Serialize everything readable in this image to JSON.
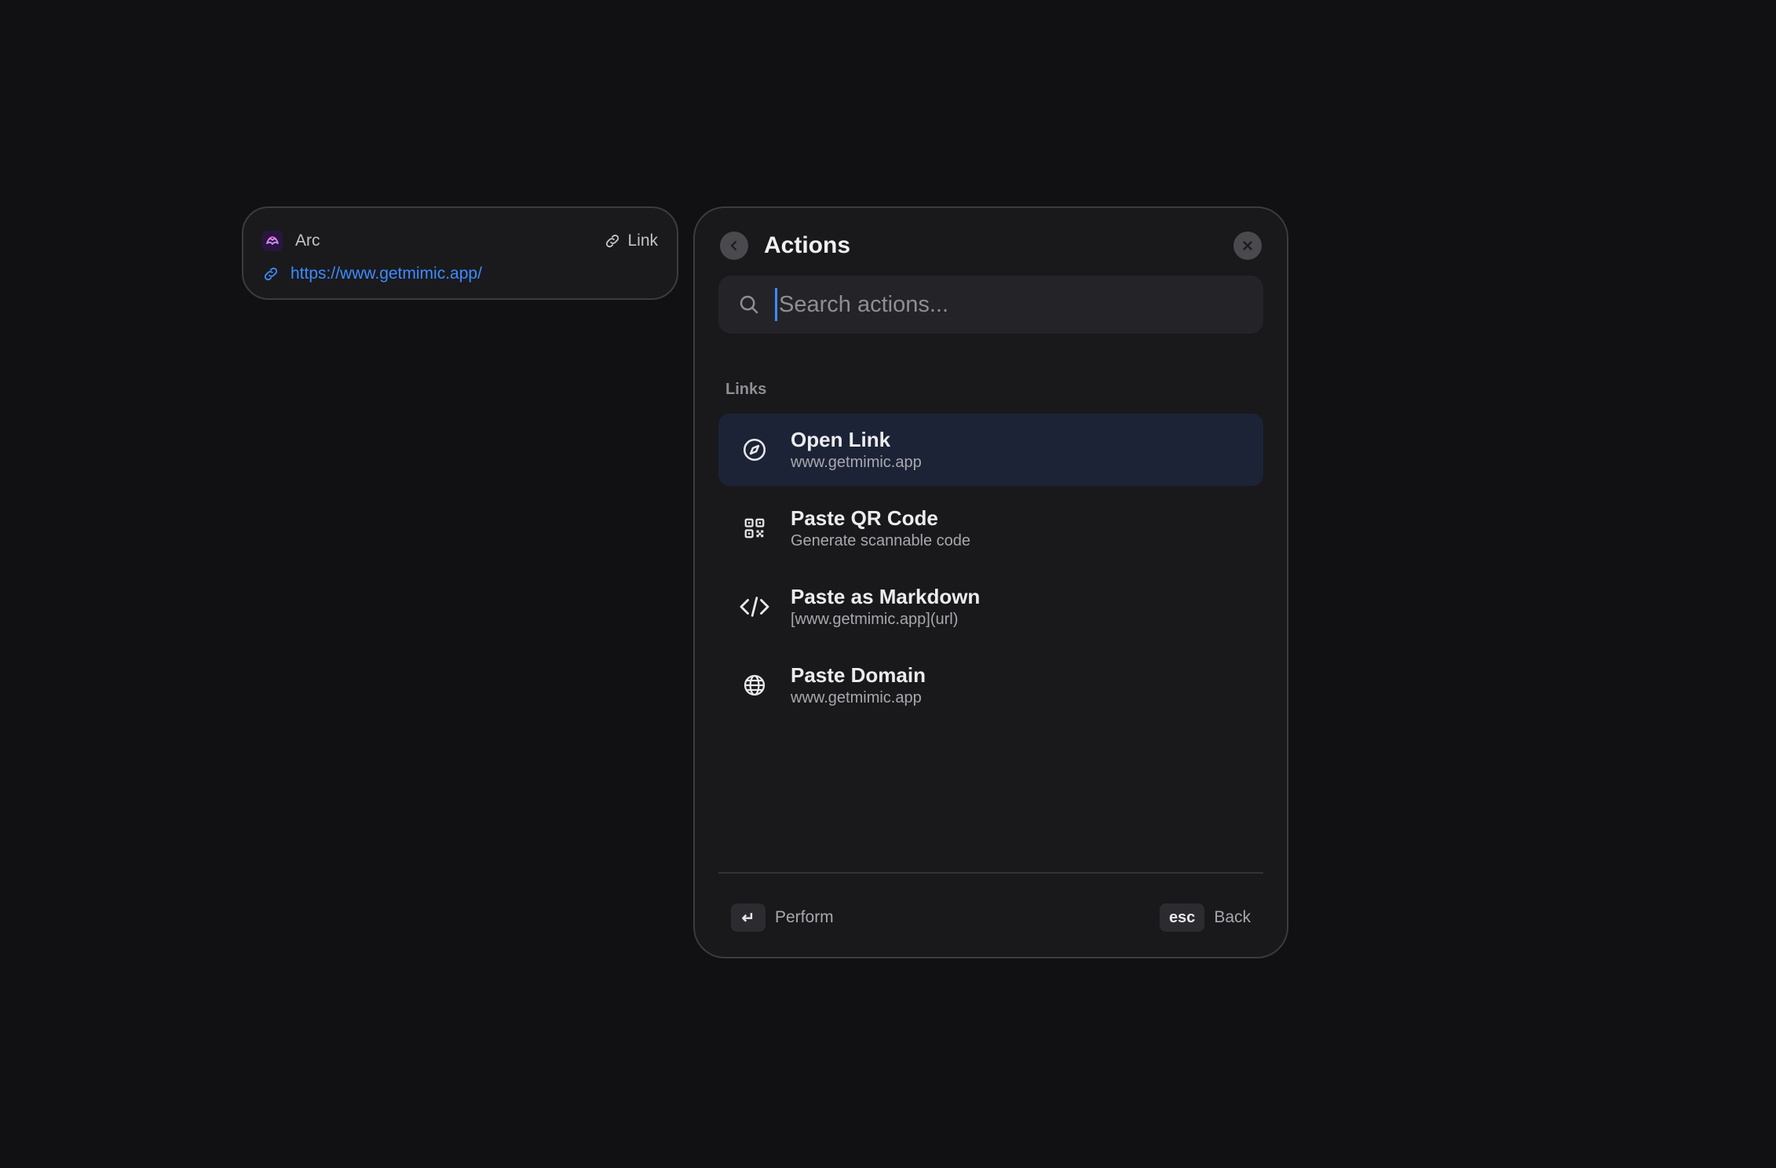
{
  "clip": {
    "app_name": "Arc",
    "app_icon": "arc-logo-icon",
    "type_label": "Link",
    "url": "https://www.getmimic.app/"
  },
  "panel": {
    "title": "Actions",
    "search_placeholder": "Search actions...",
    "section": "Links",
    "actions": [
      {
        "title": "Open Link",
        "subtitle": "www.getmimic.app",
        "icon": "compass-icon",
        "selected": true
      },
      {
        "title": "Paste QR Code",
        "subtitle": "Generate scannable code",
        "icon": "qr-code-icon",
        "selected": false
      },
      {
        "title": "Paste as Markdown",
        "subtitle": "[www.getmimic.app](url)",
        "icon": "code-icon",
        "selected": false
      },
      {
        "title": "Paste Domain",
        "subtitle": "www.getmimic.app",
        "icon": "globe-icon",
        "selected": false
      }
    ]
  },
  "footer": {
    "enter_key": "↵",
    "perform_label": "Perform",
    "esc_key": "esc",
    "back_label": "Back"
  },
  "colors": {
    "background": "#111113",
    "accent": "#3d8bff",
    "selected_row": "#1c2336"
  }
}
